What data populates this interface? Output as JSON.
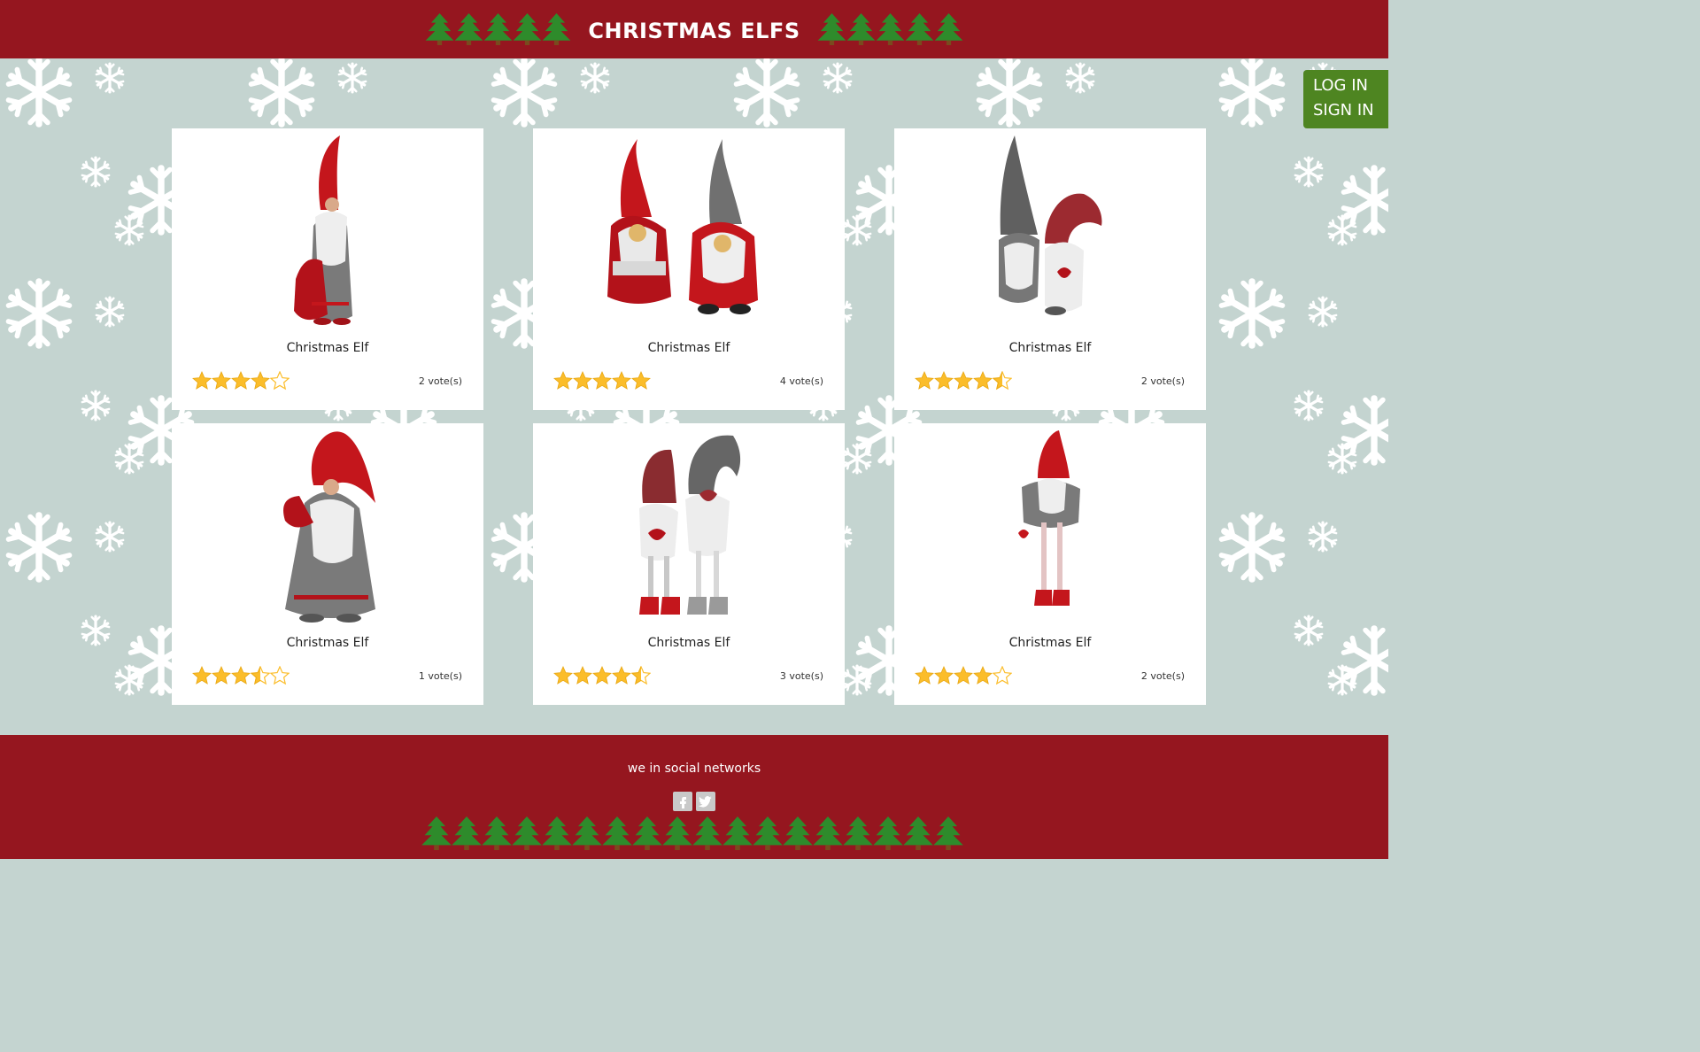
{
  "header": {
    "title": "CHRISTMAS ELFS"
  },
  "auth": {
    "login_label": "LOG IN",
    "signin_label": "SIGN IN"
  },
  "cards": [
    {
      "title": "Christmas Elf",
      "votes": "2 vote(s)",
      "rating": 4.0,
      "max_rating": 5,
      "variant": "tall-red-sack"
    },
    {
      "title": "Christmas Elf",
      "votes": "4 vote(s)",
      "rating": 5.0,
      "max_rating": 5,
      "variant": "pair-red-grey"
    },
    {
      "title": "Christmas Elf",
      "votes": "2 vote(s)",
      "rating": 4.5,
      "max_rating": 5,
      "variant": "pair-knit"
    },
    {
      "title": "Christmas Elf",
      "votes": "1 vote(s)",
      "rating": 3.5,
      "max_rating": 5,
      "variant": "grey-robe-red-hat"
    },
    {
      "title": "Christmas Elf",
      "votes": "3 vote(s)",
      "rating": 4.5,
      "max_rating": 5,
      "variant": "pair-long-legs"
    },
    {
      "title": "Christmas Elf",
      "votes": "2 vote(s)",
      "rating": 4.0,
      "max_rating": 5,
      "variant": "small-long-legs"
    }
  ],
  "footer": {
    "social_text": "we in social networks"
  },
  "social_icons": [
    "facebook-icon",
    "twitter-icon"
  ],
  "colors": {
    "brand_red": "#95161f",
    "auth_green": "#4e8521",
    "star_gold": "#fbbd2a",
    "tree_green": "#2e8b2b",
    "background": "#c4d4d0"
  }
}
